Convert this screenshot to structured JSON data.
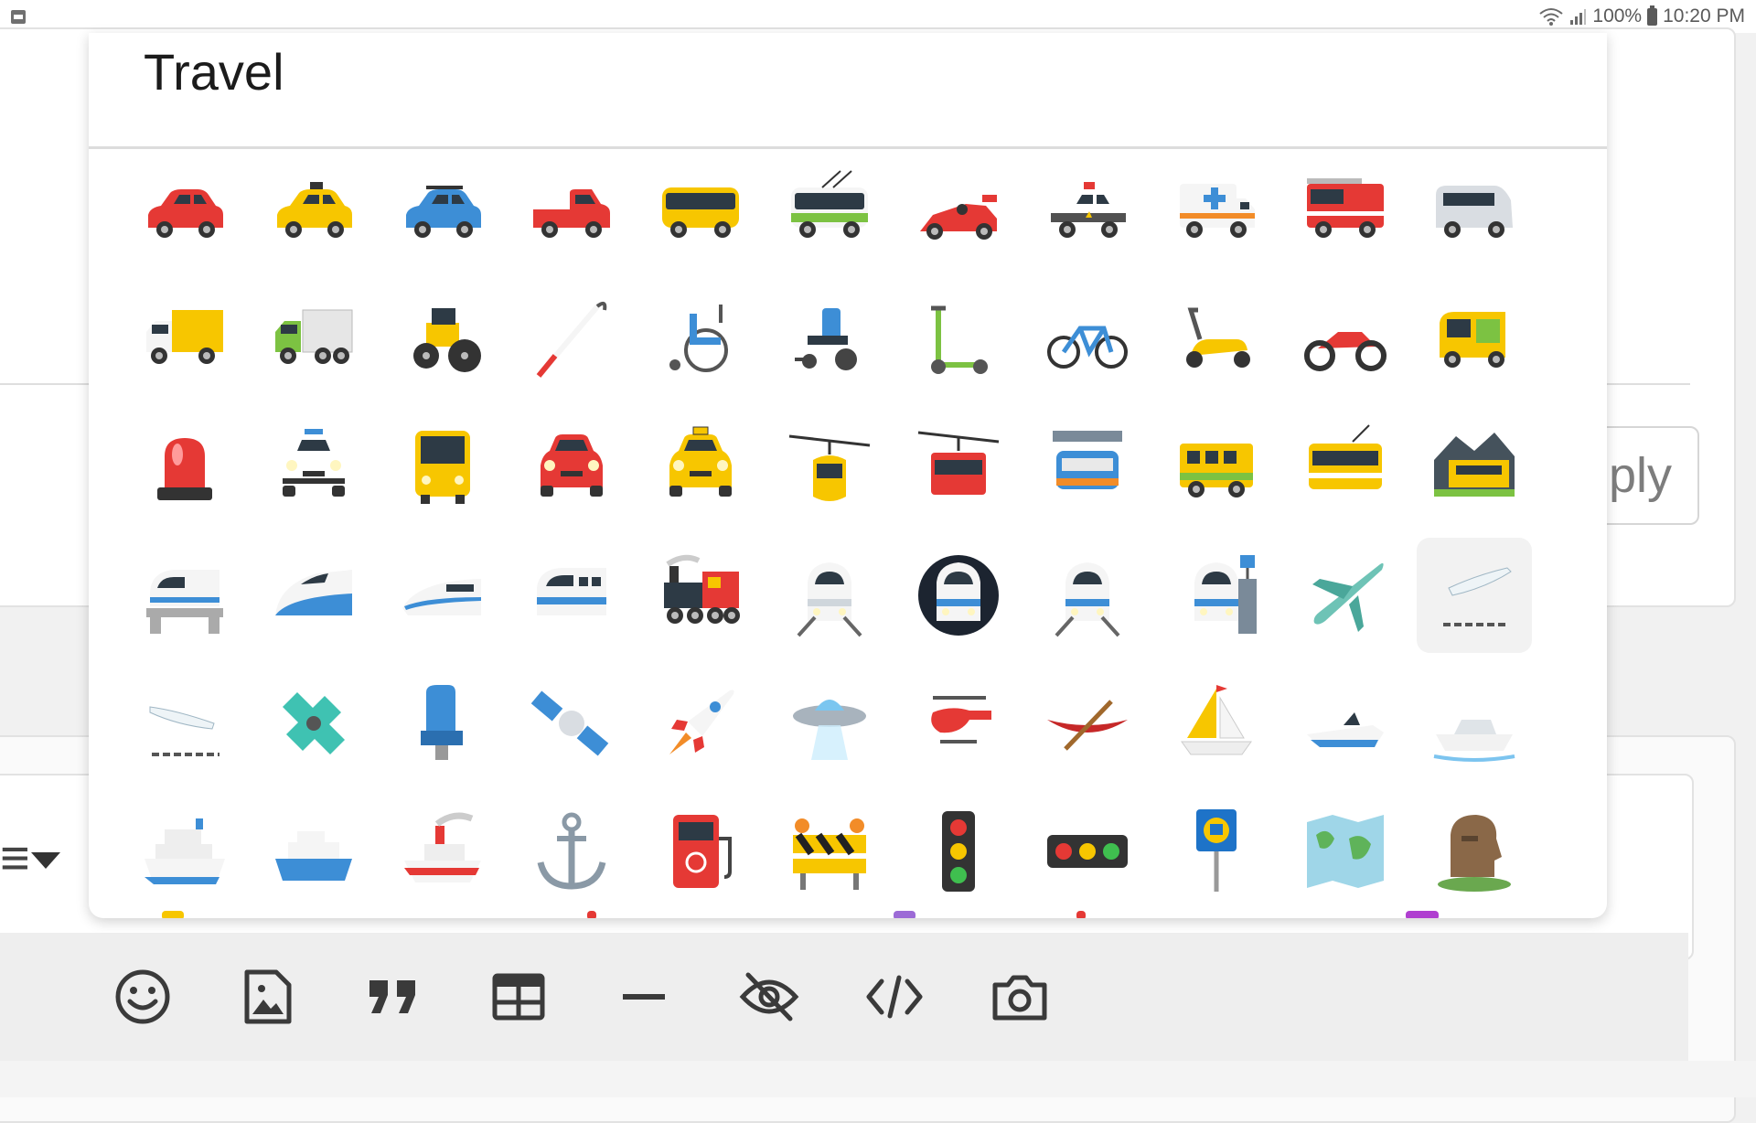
{
  "status_bar": {
    "battery_percent": "100%",
    "time": "10:20 PM",
    "left_icon": "notification-badge-icon"
  },
  "background": {
    "reply_text": "ply",
    "format_glyph": "≡"
  },
  "panel": {
    "title": "Travel",
    "selected_emoji": "airplane-departure"
  },
  "emojis": [
    [
      "red-car",
      "taxi",
      "blue-suv",
      "pickup-truck",
      "yellow-bus",
      "trolleybus",
      "racing-car",
      "police-car",
      "ambulance",
      "fire-engine",
      "minibus"
    ],
    [
      "delivery-truck",
      "articulated-lorry",
      "tractor",
      "white-cane",
      "manual-wheelchair",
      "motorized-wheelchair",
      "kick-scooter",
      "bicycle",
      "motor-scooter",
      "motorcycle",
      "auto-rickshaw"
    ],
    [
      "police-light",
      "oncoming-police-car",
      "oncoming-bus",
      "oncoming-automobile",
      "oncoming-taxi",
      "aerial-tramway",
      "mountain-cableway",
      "suspension-railway",
      "railway-car",
      "tram-car",
      "mountain-railway"
    ],
    [
      "monorail",
      "high-speed-train",
      "bullet-train",
      "light-rail",
      "locomotive",
      "train",
      "metro",
      "tram",
      "station",
      "airplane",
      "airplane-departure"
    ],
    [
      "airplane-arrival",
      "small-airplane",
      "seat",
      "satellite",
      "rocket",
      "flying-saucer",
      "helicopter",
      "canoe",
      "sailboat",
      "speedboat",
      "motor-boat"
    ],
    [
      "passenger-ship",
      "ferry",
      "ship",
      "anchor",
      "fuel-pump",
      "construction",
      "vertical-traffic-light",
      "horizontal-traffic-light",
      "bus-stop",
      "world-map",
      "moai"
    ]
  ],
  "toolbar": [
    {
      "name": "emoji-button",
      "icon": "smiley-icon"
    },
    {
      "name": "image-button",
      "icon": "image-icon"
    },
    {
      "name": "quote-button",
      "icon": "quote-icon"
    },
    {
      "name": "table-button",
      "icon": "table-icon"
    },
    {
      "name": "divider-button",
      "icon": "horizontal-rule-icon"
    },
    {
      "name": "spoiler-button",
      "icon": "eye-off-icon"
    },
    {
      "name": "code-button",
      "icon": "code-icon"
    },
    {
      "name": "camera-button",
      "icon": "camera-icon"
    }
  ],
  "colors": {
    "toolbar_icon": "#3a3a3a",
    "panel_bg": "#ffffff",
    "red": "#e53935",
    "yellow": "#f7c600",
    "blue": "#3d8ed6"
  }
}
